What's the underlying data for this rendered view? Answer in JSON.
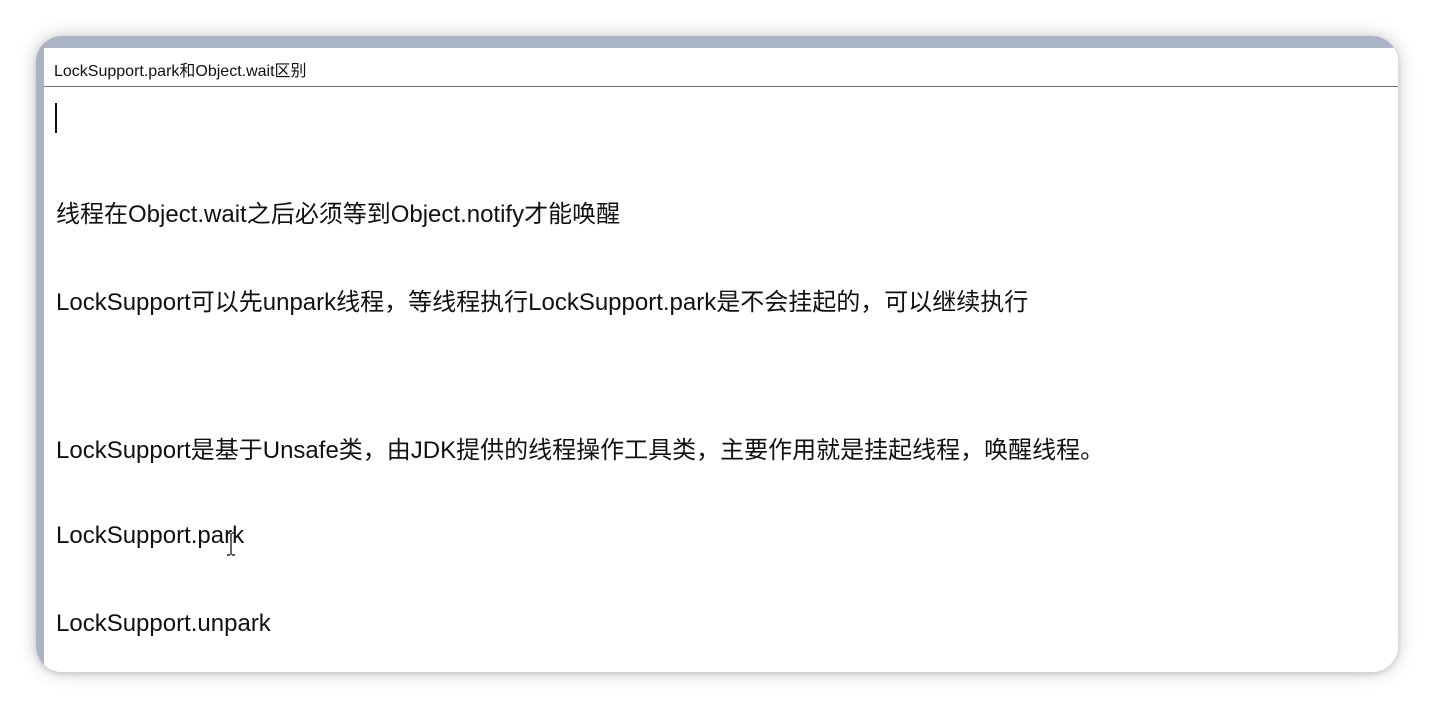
{
  "document": {
    "title": "LockSupport.park和Object.wait区别",
    "lines": [
      "线程在Object.wait之后必须等到Object.notify才能唤醒",
      "LockSupport可以先unpark线程，等线程执行LockSupport.park是不会挂起的，可以继续执行",
      "LockSupport是基于Unsafe类，由JDK提供的线程操作工具类，主要作用就是挂起线程，唤醒线程。",
      "LockSupport.park",
      "LockSupport.unpark"
    ]
  },
  "icons": {
    "text_cursor": "text-cursor-icon"
  },
  "colors": {
    "frame": "#a9b4c7",
    "text": "#111111",
    "background": "#ffffff"
  }
}
